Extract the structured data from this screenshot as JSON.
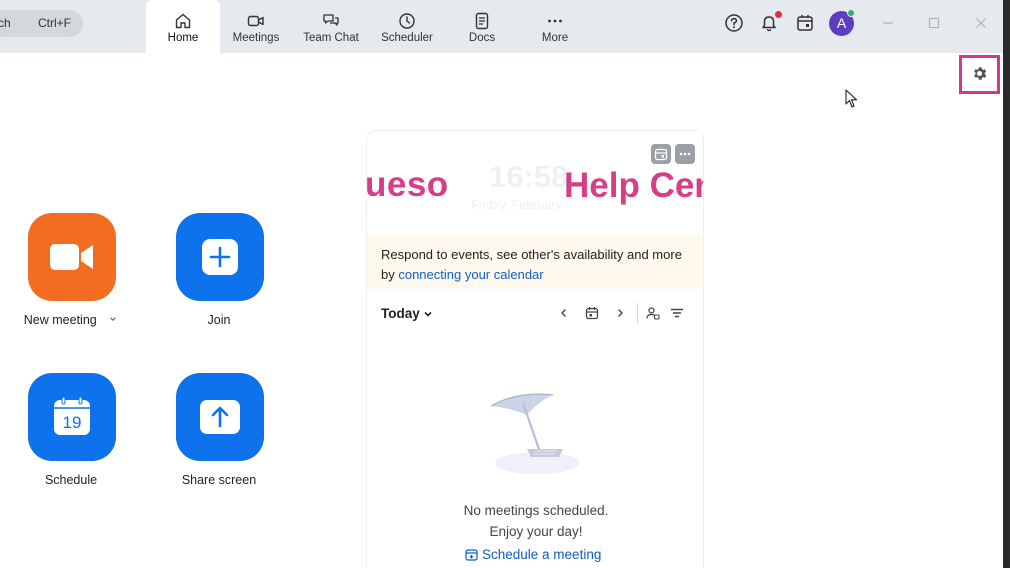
{
  "topbar": {
    "search": {
      "text": "ch",
      "shortcut": "Ctrl+F"
    },
    "tabs": [
      {
        "label": "Home",
        "icon": "home-icon",
        "active": true
      },
      {
        "label": "Meetings",
        "icon": "video-camera-icon"
      },
      {
        "label": "Team Chat",
        "icon": "chat-bubbles-icon"
      },
      {
        "label": "Scheduler",
        "icon": "clock-icon"
      },
      {
        "label": "Docs",
        "icon": "document-icon"
      },
      {
        "label": "More",
        "icon": "more-dots-icon"
      }
    ],
    "avatar_initial": "A"
  },
  "actions": [
    {
      "label": "New meeting",
      "icon": "video-camera-icon",
      "color": "#f26d21",
      "has_dropdown": true
    },
    {
      "label": "Join",
      "icon": "plus-icon",
      "color": "#0e72ed"
    },
    {
      "label": "Schedule",
      "icon": "calendar-19-icon",
      "color": "#0e72ed",
      "day": "19"
    },
    {
      "label": "Share screen",
      "icon": "upload-arrow-icon",
      "color": "#0e72ed"
    }
  ],
  "panel": {
    "banner": {
      "left_text": "ueso",
      "right_text": "Help Cen",
      "clock": "16:58",
      "date": "Friday, February"
    },
    "notice": {
      "text": "Respond to events, see other's availability and more by ",
      "link": "connecting your calendar"
    },
    "toolbar": {
      "today_label": "Today"
    },
    "empty": {
      "line1": "No meetings scheduled.",
      "line2": "Enjoy your day!",
      "schedule_link": "Schedule a meeting"
    }
  },
  "colors": {
    "accent_blue": "#0e72ed",
    "accent_orange": "#f26d21",
    "highlight_pink": "#d4388a",
    "banner_pink": "#d63f86"
  }
}
